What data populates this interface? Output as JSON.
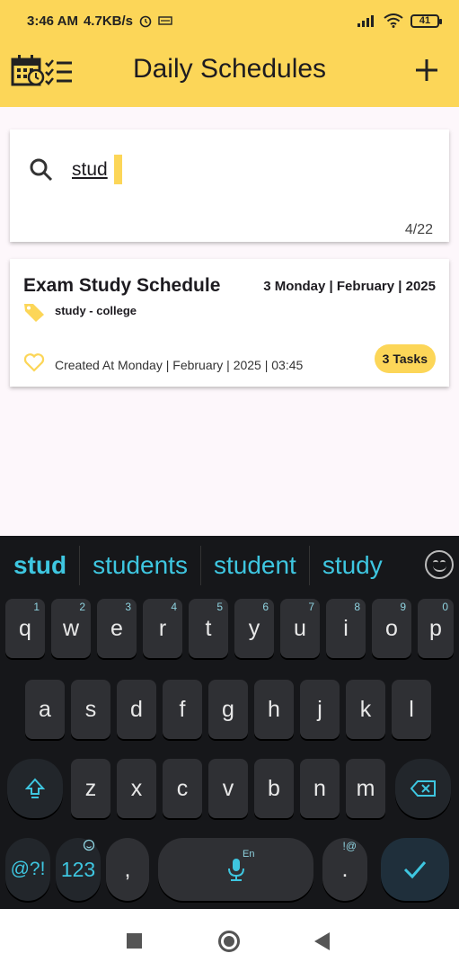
{
  "status_bar": {
    "time": "3:46 AM",
    "speed": "4.7KB/s",
    "battery": "41"
  },
  "app_bar": {
    "title": "Daily Schedules",
    "add_label": "+"
  },
  "search": {
    "value": "stud",
    "counter": "4/22"
  },
  "schedules": [
    {
      "title": "Exam Study Schedule",
      "date": "3 Monday | February | 2025",
      "tag": "study - college",
      "created": "Created At Monday | February | 2025 | 03:45",
      "tasks": "3 Tasks"
    }
  ],
  "keyboard": {
    "suggestions": [
      "stud",
      "students",
      "student",
      "study"
    ],
    "row1": [
      {
        "key": "q",
        "hint": "1"
      },
      {
        "key": "w",
        "hint": "2"
      },
      {
        "key": "e",
        "hint": "3"
      },
      {
        "key": "r",
        "hint": "4"
      },
      {
        "key": "t",
        "hint": "5"
      },
      {
        "key": "y",
        "hint": "6"
      },
      {
        "key": "u",
        "hint": "7"
      },
      {
        "key": "i",
        "hint": "8"
      },
      {
        "key": "o",
        "hint": "9"
      },
      {
        "key": "p",
        "hint": "0"
      }
    ],
    "row2": [
      "a",
      "s",
      "d",
      "f",
      "g",
      "h",
      "j",
      "k",
      "l"
    ],
    "row3": [
      "z",
      "x",
      "c",
      "v",
      "b",
      "n",
      "m"
    ],
    "symbols_label": "@?!",
    "numbers_label": "123",
    "comma_label": ",",
    "period_label": ".",
    "period_hint": "!@",
    "space_lang": "En"
  },
  "colors": {
    "accent": "#fcd658",
    "keyboard_accent": "#3ec6e0"
  }
}
